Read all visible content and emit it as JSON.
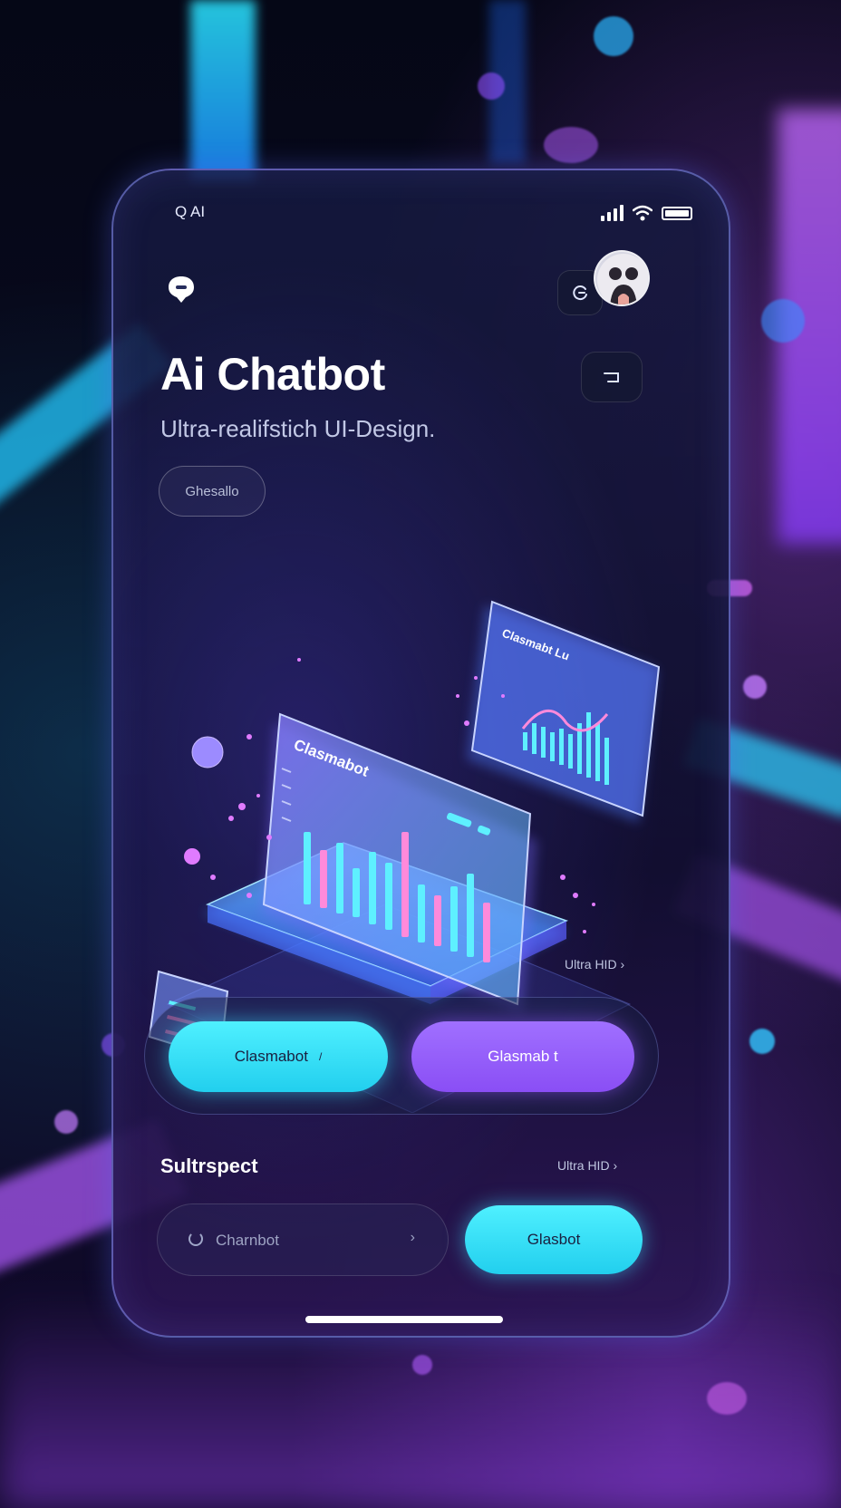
{
  "status_bar": {
    "left_text": "Q AI"
  },
  "header": {
    "chat_icon": "chat-bubble-icon",
    "refresh_icon": "refresh-icon",
    "avatar": "user-avatar",
    "corner_icon": "corner-arrow-icon"
  },
  "hero": {
    "title": "Ai Chatbot",
    "subtitle": "Ultra-realifstich UI-Design.",
    "pill_label": "Ghesallo"
  },
  "illustration": {
    "main_card_title": "Clasmabot",
    "floating_card_title": "Clasmabt Lu"
  },
  "badges": {
    "top": "Ultra HID",
    "bottom": "Ultra HID"
  },
  "actions": {
    "primary_label": "Clasmabot",
    "secondary_label": "Glasmab t"
  },
  "section": {
    "title": "Sultrspect",
    "search_placeholder": "Charnbot",
    "action_label": "Glasbot"
  },
  "colors": {
    "accent_cyan": "#3fe6ff",
    "accent_purple": "#9a5cff",
    "background": "#06071a"
  }
}
